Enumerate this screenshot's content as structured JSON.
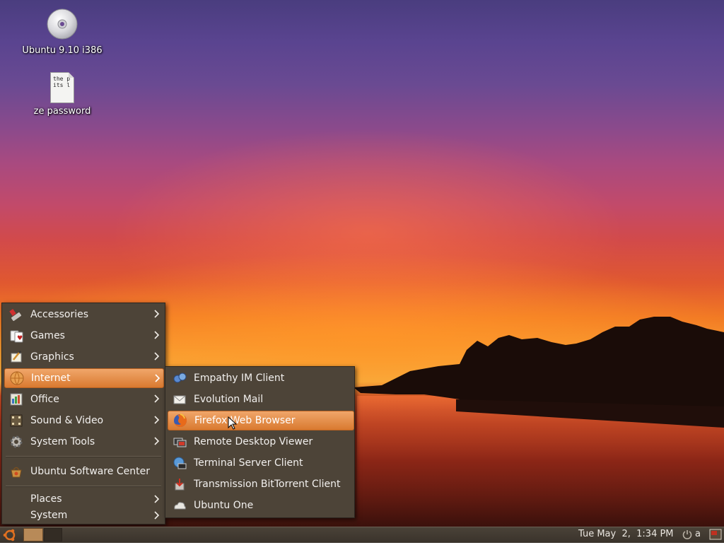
{
  "desktop": {
    "icons": [
      {
        "label": "Ubuntu 9.10 i386",
        "icon": "cd-icon"
      },
      {
        "label": "ze password",
        "icon": "text-file-icon",
        "preview": "the p\nits l"
      }
    ]
  },
  "applications_menu": {
    "items": [
      {
        "label": "Accessories",
        "icon": "accessories-icon",
        "submenu": true
      },
      {
        "label": "Games",
        "icon": "games-icon",
        "submenu": true
      },
      {
        "label": "Graphics",
        "icon": "graphics-icon",
        "submenu": true
      },
      {
        "label": "Internet",
        "icon": "internet-icon",
        "submenu": true,
        "active": true
      },
      {
        "label": "Office",
        "icon": "office-icon",
        "submenu": true
      },
      {
        "label": "Sound & Video",
        "icon": "sound-video-icon",
        "submenu": true
      },
      {
        "label": "System Tools",
        "icon": "system-tools-icon",
        "submenu": true
      },
      {
        "label": "Ubuntu Software Center",
        "icon": "software-center-icon",
        "submenu": false
      },
      {
        "label": "Places",
        "icon": "",
        "submenu": true
      },
      {
        "label": "System",
        "icon": "",
        "submenu": true
      }
    ]
  },
  "internet_submenu": {
    "items": [
      {
        "label": "Empathy IM Client",
        "icon": "empathy-icon"
      },
      {
        "label": "Evolution Mail",
        "icon": "evolution-mail-icon"
      },
      {
        "label": "Firefox Web Browser",
        "icon": "firefox-icon",
        "active": true
      },
      {
        "label": "Remote Desktop Viewer",
        "icon": "remote-desktop-icon"
      },
      {
        "label": "Terminal Server Client",
        "icon": "terminal-server-icon"
      },
      {
        "label": "Transmission BitTorrent Client",
        "icon": "transmission-icon"
      },
      {
        "label": "Ubuntu One",
        "icon": "ubuntu-one-icon"
      }
    ]
  },
  "panel": {
    "clock": "Tue May  2,  1:34 PM",
    "user": "a"
  },
  "colors": {
    "menu_bg": "#4d4438",
    "highlight": "#e08a40",
    "panel_bg": "#3e372e"
  }
}
